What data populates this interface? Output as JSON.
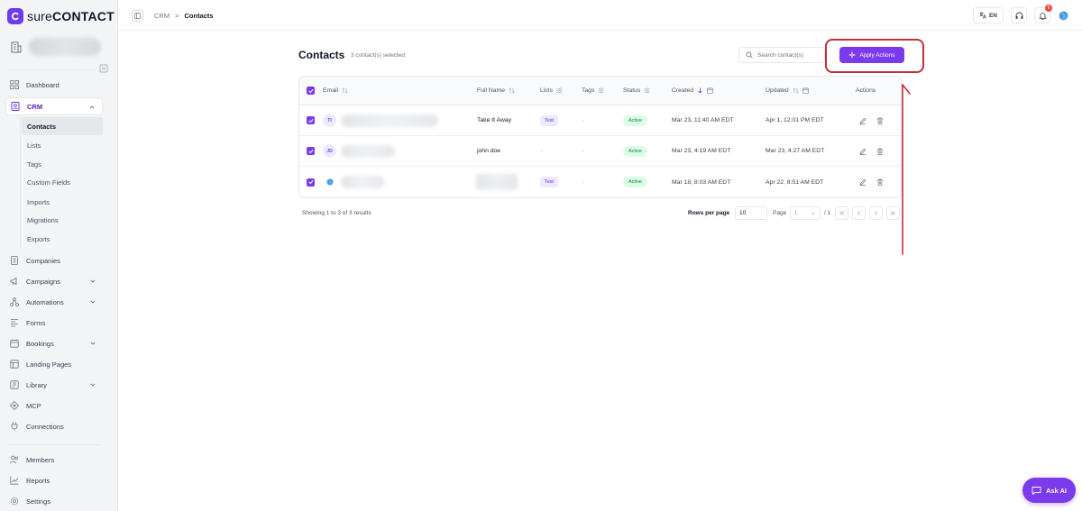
{
  "app": {
    "logo_prefix": "sure",
    "logo_suffix": "CONTACT"
  },
  "sidebar": {
    "items": [
      {
        "label": "Dashboard"
      },
      {
        "label": "CRM"
      },
      {
        "label": "Companies"
      },
      {
        "label": "Campaigns"
      },
      {
        "label": "Automations"
      },
      {
        "label": "Forms"
      },
      {
        "label": "Bookings"
      },
      {
        "label": "Landing Pages"
      },
      {
        "label": "Library"
      },
      {
        "label": "MCP"
      },
      {
        "label": "Connections"
      },
      {
        "label": "Members"
      },
      {
        "label": "Reports"
      },
      {
        "label": "Settings"
      }
    ],
    "crm_sub": [
      {
        "label": "Contacts"
      },
      {
        "label": "Lists"
      },
      {
        "label": "Tags"
      },
      {
        "label": "Custom Fields"
      },
      {
        "label": "Imports"
      },
      {
        "label": "Migrations"
      },
      {
        "label": "Exports"
      }
    ]
  },
  "topbar": {
    "breadcrumb": {
      "parent": "CRM",
      "separator": ">",
      "current": "Contacts"
    },
    "lang": "EN",
    "notifications": "6"
  },
  "page": {
    "title": "Contacts",
    "selected_count": "3 contact(s) selected",
    "search_placeholder": "Search contact(s)",
    "apply_label": "Apply Actions"
  },
  "table": {
    "columns": {
      "email": "Email",
      "full_name": "Full Name",
      "lists": "Lists",
      "tags": "Tags",
      "status": "Status",
      "created": "Created",
      "updated": "Updated",
      "actions": "Actions"
    },
    "rows": [
      {
        "initials": "TI",
        "full_name": "Take It Away",
        "list": "Test",
        "tags": "-",
        "status": "Active",
        "created": "Mar 23, 11:40 AM EDT",
        "updated": "Apr 1, 12:01 PM EDT"
      },
      {
        "initials": "JD",
        "full_name": "john doe",
        "list": "-",
        "tags": "-",
        "status": "Active",
        "created": "Mar 23, 4:19 AM EDT",
        "updated": "Mar 23, 4:27 AM EDT"
      },
      {
        "initials": "",
        "full_name": "",
        "list": "Test",
        "tags": "-",
        "status": "Active",
        "created": "Mar 18, 8:03 AM EDT",
        "updated": "Apr 22, 8:51 AM EDT"
      }
    ]
  },
  "pagination": {
    "showing": "Showing 1 to 3 of 3 results",
    "rows_label": "Rows per page",
    "rows_value": "10",
    "page_label": "Page",
    "page_value": "1",
    "page_total": "/ 1"
  },
  "ask_ai": "Ask AI",
  "colors": {
    "accent": "#7c3aed",
    "highlight": "#c0303a",
    "active_green": "#15803d"
  }
}
